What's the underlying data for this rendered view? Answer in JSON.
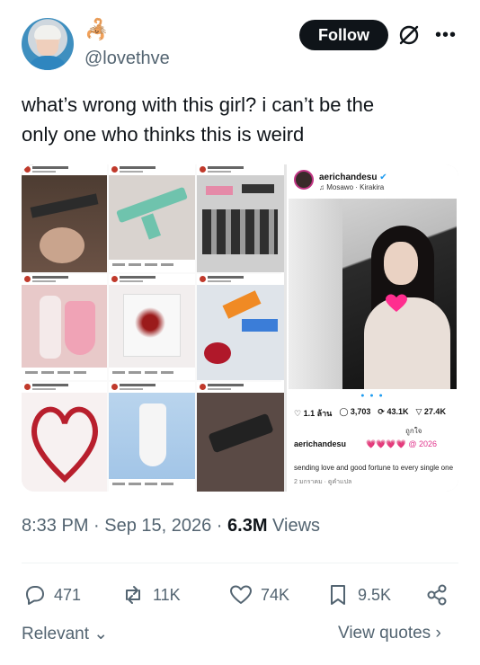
{
  "header": {
    "emoji": "🦂",
    "handle": "@lovethve",
    "follow_label": "Follow"
  },
  "icons": {
    "grok": "grok-icon",
    "more": "more-icon",
    "reply": "reply-icon",
    "retweet": "retweet-icon",
    "like": "heart-icon",
    "bookmark": "bookmark-icon",
    "share": "share-icon"
  },
  "tweet": {
    "line1": "what’s wrong with this girl? i can’t be the",
    "line2": "only one who thinks this is weird"
  },
  "embedded_post": {
    "username": "aerichandesu",
    "verified": "✔",
    "music": "♫ Mosawo · Kirakira",
    "stats": {
      "likes": "1.1 ล้าน",
      "comments": "3,703",
      "reposts": "43.1K",
      "shares": "27.4K"
    },
    "translate_label": "ถูกใจ",
    "caption_user": "aerichandesu",
    "caption_extra": "💗💗💗💗 @ 2026",
    "caption": "sending love and good fortune to every single one",
    "meta": "2 มกราคม · ดูคำแปล"
  },
  "timestamp": {
    "time_date": "8:33 PM · Sep 15, 2026 · ",
    "views_count": "6.3M",
    "views_label": " Views"
  },
  "actions": {
    "replies": "471",
    "reposts": "11K",
    "likes": "74K",
    "bookmarks": "9.5K"
  },
  "footer": {
    "relevant_label": "Relevant",
    "view_quotes_label": "View quotes"
  },
  "colors": {
    "text_primary": "#0f1419",
    "text_secondary": "#536471",
    "follow_bg": "#0f1419",
    "verified": "#1d9bf0"
  }
}
